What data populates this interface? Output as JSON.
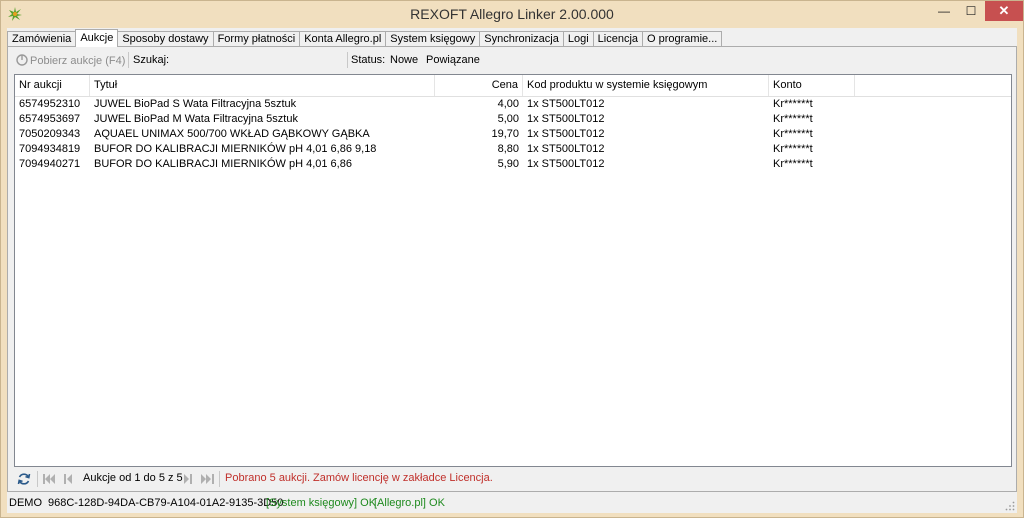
{
  "window": {
    "title": "REXOFT Allegro Linker 2.00.000",
    "min_glyph": "—",
    "max_glyph": "☐",
    "close_glyph": "✕"
  },
  "tabs": [
    "Zamówienia",
    "Aukcje",
    "Sposoby dostawy",
    "Formy płatności",
    "Konta Allegro.pl",
    "System księgowy",
    "Synchronizacja",
    "Logi",
    "Licencja",
    "O programie..."
  ],
  "toolbar": {
    "fetch_label": "Pobierz aukcje (F4)",
    "search_label": "Szukaj:",
    "status_label": "Status:",
    "status_new": "Nowe",
    "status_linked": "Powiązane"
  },
  "table": {
    "columns": [
      "Nr aukcji",
      "Tytuł",
      "Cena",
      "Kod produktu w systemie księgowym",
      "Konto"
    ],
    "rows": [
      [
        "6574952310",
        "JUWEL BioPad S Wata Filtracyjna 5sztuk",
        "4,00",
        "1x ST500LT012",
        "Kr******t"
      ],
      [
        "6574953697",
        "JUWEL BioPad M Wata Filtracyjna 5sztuk",
        "5,00",
        "1x ST500LT012",
        "Kr******t"
      ],
      [
        "7050209343",
        "AQUAEL UNIMAX 500/700 WKŁAD GĄBKOWY GĄBKA",
        "19,70",
        "1x ST500LT012",
        "Kr******t"
      ],
      [
        "7094934819",
        "BUFOR DO KALIBRACJI MIERNIKÓW pH 4,01 6,86 9,18",
        "8,80",
        "1x ST500LT012",
        "Kr******t"
      ],
      [
        "7094940271",
        "BUFOR DO KALIBRACJI MIERNIKÓW pH 4,01 6,86",
        "5,90",
        "1x ST500LT012",
        "Kr******t"
      ]
    ]
  },
  "pager": {
    "summary": "Aukcje od 1 do 5 z 5",
    "message": "Pobrano 5 aukcji. Zamów licencję w zakładce Licencja."
  },
  "statusbar": {
    "mode": "DEMO",
    "key": "968C-128D-94DA-CB79-A104-01A2-9135-3D50",
    "accounting_status": "[System księgowy] OK",
    "allegro_status": "[Allegro.pl] OK"
  },
  "colors": {
    "frame": "#f1dfbf",
    "ok": "#1f8a1f",
    "error": "#c0302b",
    "close": "#c75050"
  }
}
